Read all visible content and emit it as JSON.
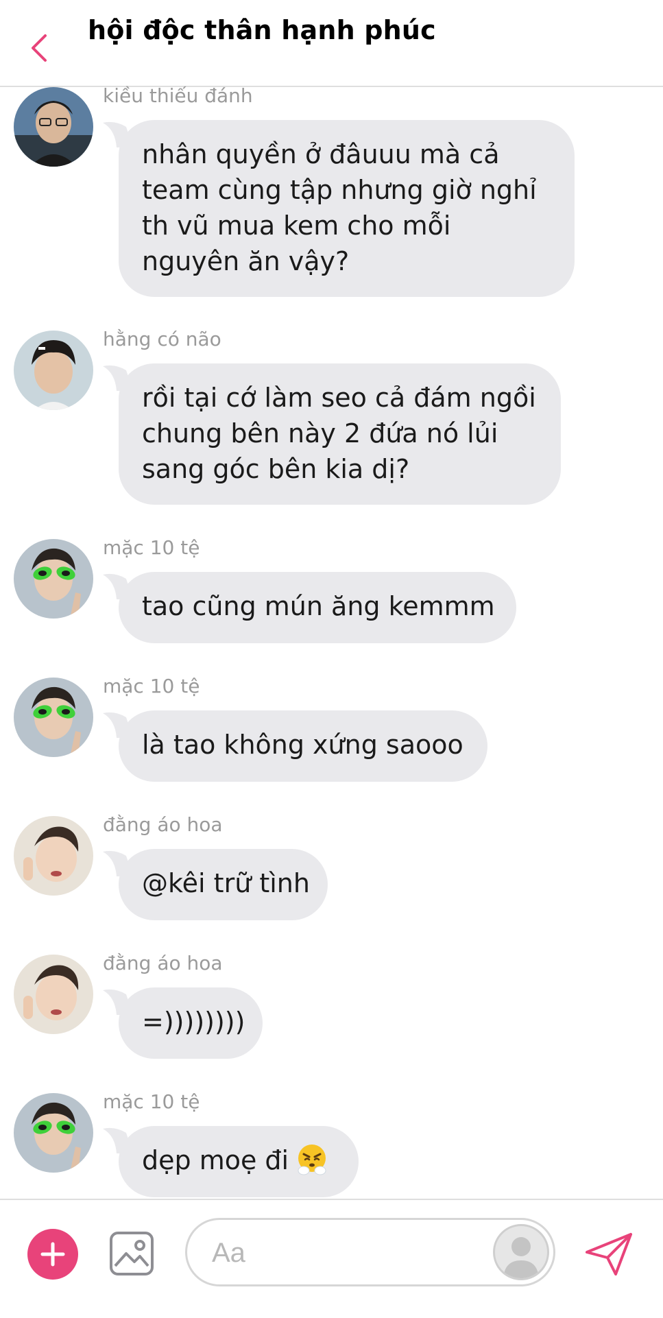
{
  "header": {
    "back_icon": "chevron-left-icon",
    "title": "hội độc thân hạnh phúc"
  },
  "messages": [
    {
      "sender": "kiều thiếu đánh",
      "text": "nhân quyền ở đâuuu mà cả team cùng tập nhưng giờ nghỉ th vũ mua kem cho mỗi nguyên ăn vậy?"
    },
    {
      "sender": "hằng có não",
      "text": "rồi tại cớ làm seo cả đám ngồi chung bên này 2 đứa nó lủi sang góc bên kia dị?"
    },
    {
      "sender": "mặc 10 tệ",
      "text": "tao cũng mún ăng kemmm"
    },
    {
      "sender": "mặc 10 tệ",
      "text": "là tao không xứng saooo"
    },
    {
      "sender": "đằng áo hoa",
      "text": "@kêi trữ tình"
    },
    {
      "sender": "đằng áo hoa",
      "text": "=))))))))"
    },
    {
      "sender": "mặc 10 tệ",
      "text": "dẹp moẹ đi",
      "emoji": "angry-steam-emoji"
    }
  ],
  "composer": {
    "plus_icon": "plus-icon",
    "photo_icon": "image-icon",
    "placeholder": "Aa",
    "avatar_icon": "user-avatar-icon",
    "send_icon": "send-icon"
  },
  "colors": {
    "accent": "#e8437a",
    "bubble": "#e9e9ec",
    "sender_text": "#9a9a9a"
  }
}
